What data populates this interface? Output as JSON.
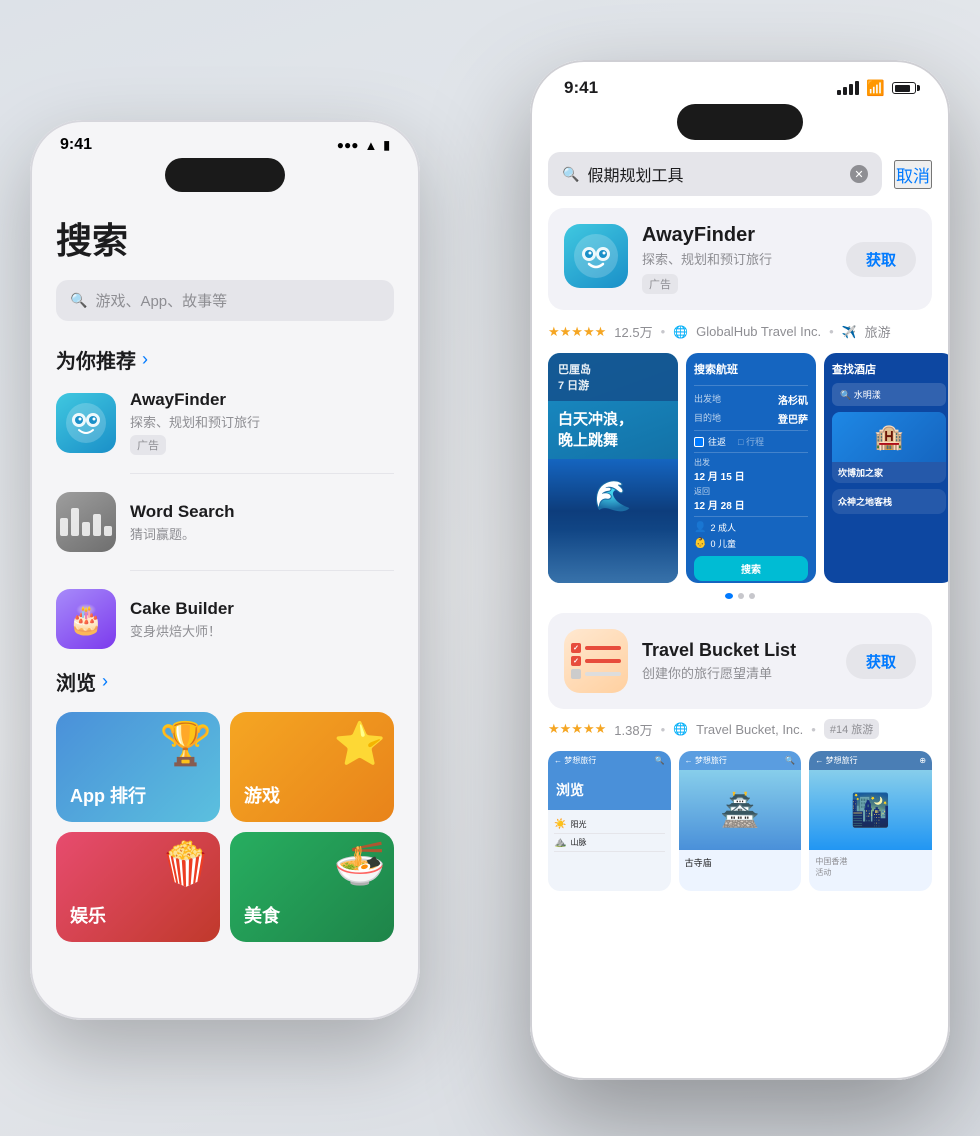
{
  "background": "#e8eaed",
  "back_phone": {
    "time": "9:41",
    "title": "搜索",
    "search_placeholder": "游戏、App、故事等",
    "recommended_section": "为你推荐",
    "browse_section": "浏览",
    "apps": [
      {
        "name": "AwayFinder",
        "desc": "探索、规划和预订旅行",
        "badge": "广告",
        "type": "awayfinder"
      },
      {
        "name": "Word Search",
        "desc": "猜词赢题。",
        "badge": null,
        "type": "wordsearch"
      },
      {
        "name": "Cake Builder",
        "desc": "变身烘焙大师！",
        "badge": null,
        "type": "cakebuilder"
      }
    ],
    "browse_cards": [
      {
        "label": "App 排行",
        "type": "appranking"
      },
      {
        "label": "游戏",
        "type": "games"
      },
      {
        "label": "娱乐",
        "type": "entertainment"
      },
      {
        "label": "美食",
        "type": "food"
      }
    ]
  },
  "front_phone": {
    "time": "9:41",
    "search_query": "假期规划工具",
    "cancel_label": "取消",
    "app1": {
      "name": "AwayFinder",
      "desc": "探索、规划和预订旅行",
      "badge": "广告",
      "get_label": "获取",
      "rating": "★★★★★",
      "rating_count": "12.5万",
      "developer": "GlobalHub Travel Inc.",
      "category": "旅游",
      "screenshots": [
        {
          "label": "巴厘岛 7 日游",
          "subtitle": "白天冲浪，晚上跳舞"
        },
        {
          "label": "搜索航班",
          "from": "洛杉矶",
          "to": "登巴萨",
          "date1": "12 月 15 日",
          "date2": "12 月 28 日",
          "adults": "2 成人",
          "children": "0 儿童",
          "search_btn": "搜索"
        },
        {
          "label": "查找酒店",
          "search_placeholder": "水明漾",
          "hotel1": "坎博加之家",
          "hotel2": "众神之地客栈"
        }
      ]
    },
    "app2": {
      "name": "Travel Bucket List",
      "desc": "创建你的旅行愿望清单",
      "get_label": "获取",
      "rating": "★★★★★",
      "rating_count": "1.38万",
      "developer": "Travel Bucket, Inc.",
      "rank": "#14",
      "category": "旅游"
    }
  }
}
